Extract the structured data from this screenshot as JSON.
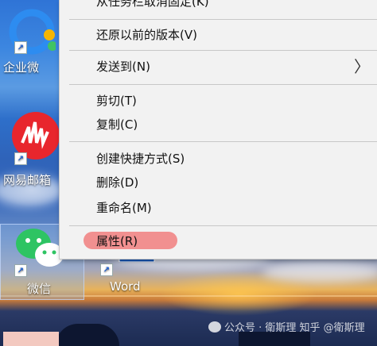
{
  "context_menu": {
    "items": [
      {
        "label": "从任务栏取消固定(K)"
      },
      {
        "label": "还原以前的版本(V)"
      },
      {
        "label": "发送到(N)"
      },
      {
        "label": "剪切(T)"
      },
      {
        "label": "复制(C)"
      },
      {
        "label": "创建快捷方式(S)"
      },
      {
        "label": "删除(D)"
      },
      {
        "label": "重命名(M)"
      },
      {
        "label": "属性(R)"
      }
    ],
    "submenu_arrow": "〉"
  },
  "desktop": {
    "icons": [
      {
        "label": "企业微",
        "icon": "wecom-icon"
      },
      {
        "label": "网易邮箱",
        "icon": "netease-mail-icon"
      },
      {
        "label": "微信",
        "icon": "wechat-icon"
      },
      {
        "label": "Word",
        "icon": "word-icon"
      }
    ],
    "shortcut_glyph": "↗"
  },
  "watermark": {
    "text": "公众号 · 衛斯理  知乎 @衛斯理"
  },
  "colors": {
    "menu_bg": "#f2f2f2",
    "highlight": "#f08a8a",
    "wechat_green": "#2ec463",
    "netease_red": "#e8262d"
  }
}
